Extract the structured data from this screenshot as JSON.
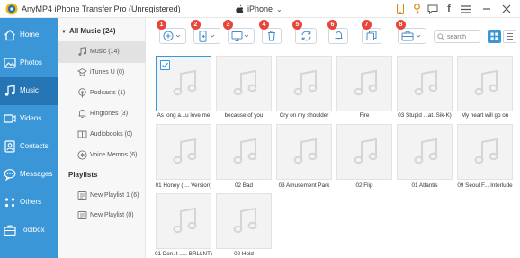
{
  "app": {
    "title": "AnyMP4 iPhone Transfer Pro (Unregistered)",
    "device": "iPhone",
    "accent_color": "#3a96d6",
    "sidebar_active_color": "#2574b3",
    "badge_color": "#e8463c",
    "titlebar_icons": [
      "phone-icon",
      "key-icon",
      "chat-icon",
      "facebook-icon",
      "menu-icon",
      "minimize-icon",
      "close-icon"
    ]
  },
  "sidebar": {
    "items": [
      {
        "label": "Home",
        "icon": "home-icon"
      },
      {
        "label": "Photos",
        "icon": "photos-icon"
      },
      {
        "label": "Music",
        "icon": "music-icon",
        "active": true
      },
      {
        "label": "Videos",
        "icon": "video-icon"
      },
      {
        "label": "Contacts",
        "icon": "contacts-icon"
      },
      {
        "label": "Messages",
        "icon": "messages-icon"
      },
      {
        "label": "Others",
        "icon": "others-icon"
      },
      {
        "label": "Toolbox",
        "icon": "toolbox-icon"
      }
    ]
  },
  "categories": {
    "all_label": "All Music (24)",
    "items": [
      {
        "label": "Music (14)",
        "icon": "music-note-icon",
        "active": true
      },
      {
        "label": "iTunes U (0)",
        "icon": "itunes-u-icon"
      },
      {
        "label": "Podcasts (1)",
        "icon": "podcast-icon"
      },
      {
        "label": "Ringtones (3)",
        "icon": "ringtone-icon"
      },
      {
        "label": "Audiobooks (0)",
        "icon": "audiobook-icon"
      },
      {
        "label": "Voice Memos (6)",
        "icon": "voice-memo-icon"
      }
    ],
    "playlists_label": "Playlists",
    "playlists": [
      {
        "label": "New Playlist 1 (6)",
        "icon": "playlist-icon"
      },
      {
        "label": "New Playlist (0)",
        "icon": "playlist-icon"
      }
    ]
  },
  "toolbar": {
    "buttons": [
      {
        "badge": "1",
        "icon": "add-icon",
        "dropdown": true
      },
      {
        "badge": "2",
        "icon": "export-to-device-icon",
        "dropdown": true
      },
      {
        "badge": "3",
        "icon": "export-to-pc-icon",
        "dropdown": true
      },
      {
        "badge": "4",
        "icon": "delete-icon"
      },
      {
        "badge": "5",
        "icon": "refresh-icon"
      },
      {
        "badge": "6",
        "icon": "ringtone-maker-icon"
      },
      {
        "badge": "7",
        "icon": "convert-icon"
      },
      {
        "badge": "8",
        "icon": "toolbox-icon",
        "dropdown": true
      }
    ],
    "search_placeholder": "search",
    "view_modes": [
      "grid-view-icon",
      "list-view-icon"
    ]
  },
  "songs": [
    {
      "title": "As long a...u love me",
      "selected": true
    },
    {
      "title": "because of you"
    },
    {
      "title": "Cry on my shoulder"
    },
    {
      "title": "Fire"
    },
    {
      "title": "03 Stupid ...at. Sik-K)"
    },
    {
      "title": "My heart will go on"
    },
    {
      "title": "01 Honey (.... Version)"
    },
    {
      "title": "02 Bad"
    },
    {
      "title": "03 Amusement Park"
    },
    {
      "title": "02 Flip"
    },
    {
      "title": "01 Atlantis"
    },
    {
      "title": "09 Seoul F... Interlude"
    },
    {
      "title": "01 Don..t ..... BRLLNT)"
    },
    {
      "title": "02 Hold"
    }
  ]
}
